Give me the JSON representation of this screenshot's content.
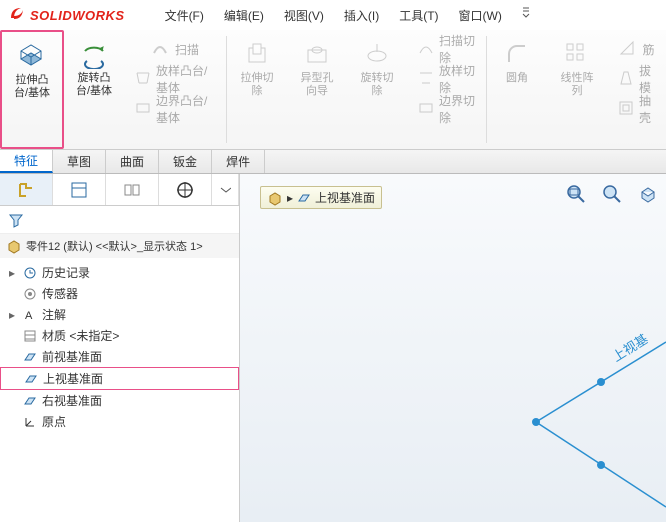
{
  "app": {
    "logo_text": "SOLIDWORKS"
  },
  "menu": {
    "file": "文件(F)",
    "edit": "编辑(E)",
    "view": "视图(V)",
    "insert": "插入(I)",
    "tools": "工具(T)",
    "window": "窗口(W)"
  },
  "ribbon": {
    "extrude": "拉伸凸台/基体",
    "revolve": "旋转凸台/基体",
    "sweep": "扫描",
    "loft": "放样凸台/基体",
    "boundary": "边界凸台/基体",
    "extrude_cut": "拉伸切除",
    "hole": "异型孔向导",
    "revolve_cut": "旋转切除",
    "sweep_cut": "扫描切除",
    "loft_cut": "放样切除",
    "boundary_cut": "边界切除",
    "fillet": "圆角",
    "pattern": "线性阵列",
    "rib": "筋",
    "draft": "拔模",
    "shell": "抽壳"
  },
  "tabs": {
    "features": "特征",
    "sketch": "草图",
    "surface": "曲面",
    "sheetmetal": "钣金",
    "weldment": "焊件"
  },
  "tree": {
    "root": "零件12 (默认) <<默认>_显示状态 1>",
    "history": "历史记录",
    "sensors": "传感器",
    "annotations": "注解",
    "material": "材质 <未指定>",
    "front": "前视基准面",
    "top": "上视基准面",
    "right": "右视基准面",
    "origin": "原点"
  },
  "breadcrumb": {
    "plane": "上视基准面"
  },
  "sketch_label": "上视基"
}
